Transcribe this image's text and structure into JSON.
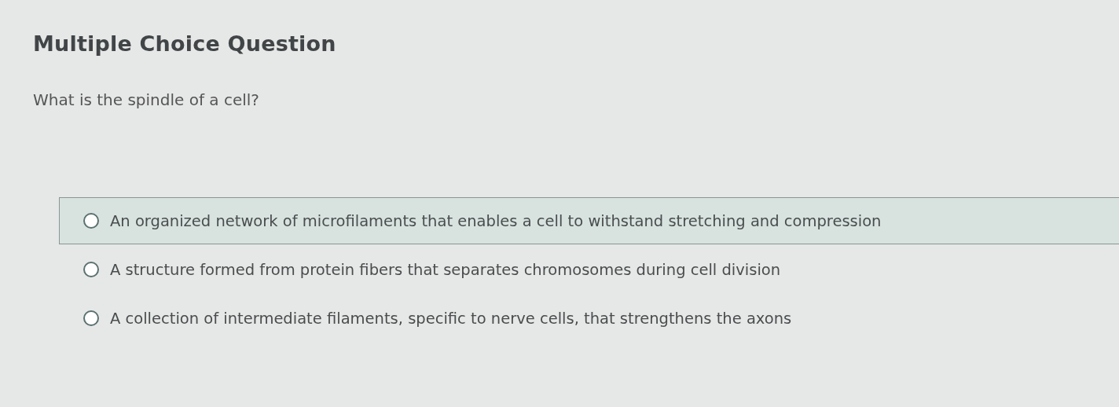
{
  "heading": "Multiple Choice Question",
  "question": "What is the spindle of a cell?",
  "options": [
    {
      "label": "An organized network of microfilaments that enables a cell to withstand stretching and compression",
      "selected": false,
      "hovered": true
    },
    {
      "label": "A structure formed from protein fibers that separates chromosomes during cell division",
      "selected": false,
      "hovered": false
    },
    {
      "label": "A collection of intermediate filaments, specific to nerve cells, that strengthens the axons",
      "selected": false,
      "hovered": false
    }
  ]
}
